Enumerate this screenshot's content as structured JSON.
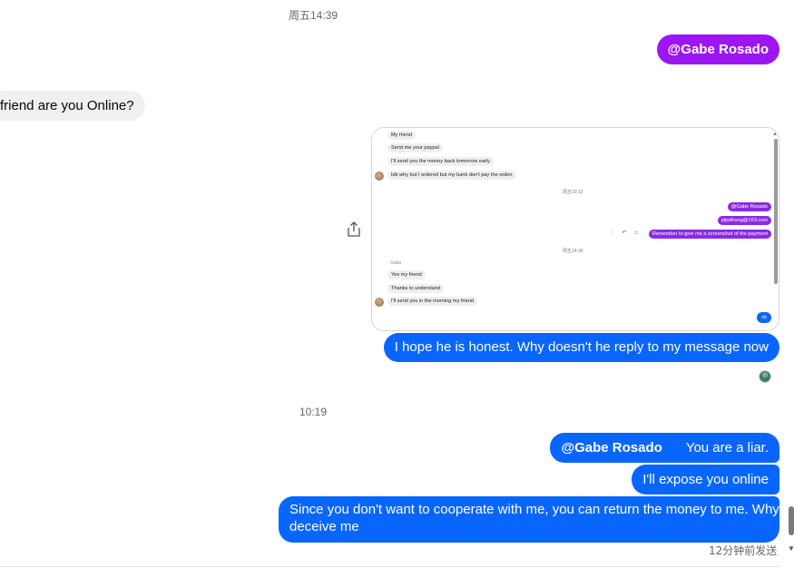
{
  "chat": {
    "time1": "周五14:39",
    "mention_top": "@Gabe Rosado",
    "incoming_partial": "friend are you Online?",
    "outgoing_hope": "I hope he is honest. Why doesn't he reply to my message now",
    "time2": "10:19",
    "liar_mention": "@Gabe Rosado",
    "liar_text": "You are a liar.",
    "expose": "I'll expose you online",
    "cooperate_line1": "Since you don't want to cooperate with me, you can return the money to me. Why",
    "cooperate_line2": "deceive me",
    "sent_status": "12分钟前发送"
  },
  "screenshot": {
    "msgs_top": [
      "My friend",
      "Send me your paypal",
      "I'll send you the money back tomorrow early",
      "Idk why but I ordered but my bank don't pay the orden"
    ],
    "time_a": "周五10:12",
    "out_mention": "@Gabe Rosado",
    "out_email": "plpsthang@163.com",
    "out_remember": "Remember to give me a screenshot of the payment",
    "time_b": "周五14:39",
    "sender_name": "Gabe",
    "msgs_bottom": [
      "Yes my friend",
      "Thanks to understand",
      "I'll send you in the morning my friend"
    ],
    "out_ok": "ok",
    "mini_icons": "⋮ ↶ ☺"
  },
  "icons": {
    "share": "share-icon",
    "seen": "seen-avatar"
  },
  "colors": {
    "outgoing": "#0866ff",
    "mention_bubble": "#9d16f2",
    "incoming": "#f0f0f0"
  }
}
